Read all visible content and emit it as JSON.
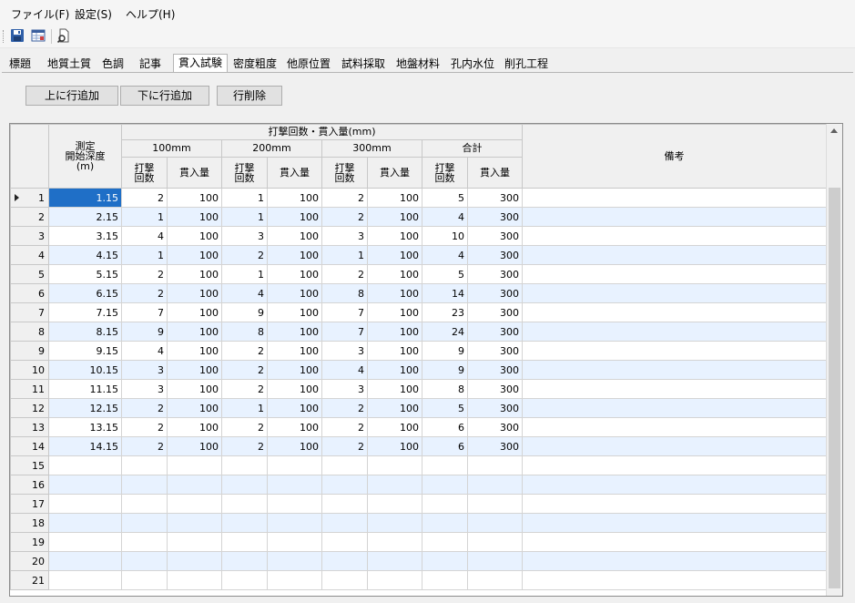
{
  "menu": {
    "file": "ファイル(F)",
    "settings": "設定(S)",
    "help": "ヘルプ(H)"
  },
  "toolbar": {
    "icons": [
      "save-icon",
      "table-view-icon",
      "print-preview-icon"
    ]
  },
  "tabs": [
    {
      "label": "標題",
      "active": false
    },
    {
      "label": "地質土質",
      "active": false
    },
    {
      "label": "色調",
      "active": false
    },
    {
      "label": "記事",
      "active": false
    },
    {
      "label": "貫入試験",
      "active": true
    },
    {
      "label": "密度粗度",
      "active": false
    },
    {
      "label": "他原位置",
      "active": false
    },
    {
      "label": "試料採取",
      "active": false
    },
    {
      "label": "地盤材料",
      "active": false
    },
    {
      "label": "孔内水位",
      "active": false
    },
    {
      "label": "削孔工程",
      "active": false
    }
  ],
  "actions": {
    "add_above": "上に行追加",
    "add_below": "下に行追加",
    "delete_row": "行削除"
  },
  "grid": {
    "header": {
      "depth_line1": "測定",
      "depth_line2": "開始深度",
      "depth_line3": "(m)",
      "group": "打撃回数・貫入量(mm)",
      "g100": "100mm",
      "g200": "200mm",
      "g300": "300mm",
      "gtotal": "合計",
      "blows_line1": "打撃",
      "blows_line2": "回数",
      "pen": "貫入量",
      "remarks": "備考"
    },
    "rows": [
      {
        "no": "1",
        "depth": "1.15",
        "b1": "2",
        "p1": "100",
        "b2": "1",
        "p2": "100",
        "b3": "2",
        "p3": "100",
        "bt": "5",
        "pt": "300",
        "note": ""
      },
      {
        "no": "2",
        "depth": "2.15",
        "b1": "1",
        "p1": "100",
        "b2": "1",
        "p2": "100",
        "b3": "2",
        "p3": "100",
        "bt": "4",
        "pt": "300",
        "note": ""
      },
      {
        "no": "3",
        "depth": "3.15",
        "b1": "4",
        "p1": "100",
        "b2": "3",
        "p2": "100",
        "b3": "3",
        "p3": "100",
        "bt": "10",
        "pt": "300",
        "note": ""
      },
      {
        "no": "4",
        "depth": "4.15",
        "b1": "1",
        "p1": "100",
        "b2": "2",
        "p2": "100",
        "b3": "1",
        "p3": "100",
        "bt": "4",
        "pt": "300",
        "note": ""
      },
      {
        "no": "5",
        "depth": "5.15",
        "b1": "2",
        "p1": "100",
        "b2": "1",
        "p2": "100",
        "b3": "2",
        "p3": "100",
        "bt": "5",
        "pt": "300",
        "note": ""
      },
      {
        "no": "6",
        "depth": "6.15",
        "b1": "2",
        "p1": "100",
        "b2": "4",
        "p2": "100",
        "b3": "8",
        "p3": "100",
        "bt": "14",
        "pt": "300",
        "note": ""
      },
      {
        "no": "7",
        "depth": "7.15",
        "b1": "7",
        "p1": "100",
        "b2": "9",
        "p2": "100",
        "b3": "7",
        "p3": "100",
        "bt": "23",
        "pt": "300",
        "note": ""
      },
      {
        "no": "8",
        "depth": "8.15",
        "b1": "9",
        "p1": "100",
        "b2": "8",
        "p2": "100",
        "b3": "7",
        "p3": "100",
        "bt": "24",
        "pt": "300",
        "note": ""
      },
      {
        "no": "9",
        "depth": "9.15",
        "b1": "4",
        "p1": "100",
        "b2": "2",
        "p2": "100",
        "b3": "3",
        "p3": "100",
        "bt": "9",
        "pt": "300",
        "note": ""
      },
      {
        "no": "10",
        "depth": "10.15",
        "b1": "3",
        "p1": "100",
        "b2": "2",
        "p2": "100",
        "b3": "4",
        "p3": "100",
        "bt": "9",
        "pt": "300",
        "note": ""
      },
      {
        "no": "11",
        "depth": "11.15",
        "b1": "3",
        "p1": "100",
        "b2": "2",
        "p2": "100",
        "b3": "3",
        "p3": "100",
        "bt": "8",
        "pt": "300",
        "note": ""
      },
      {
        "no": "12",
        "depth": "12.15",
        "b1": "2",
        "p1": "100",
        "b2": "1",
        "p2": "100",
        "b3": "2",
        "p3": "100",
        "bt": "5",
        "pt": "300",
        "note": ""
      },
      {
        "no": "13",
        "depth": "13.15",
        "b1": "2",
        "p1": "100",
        "b2": "2",
        "p2": "100",
        "b3": "2",
        "p3": "100",
        "bt": "6",
        "pt": "300",
        "note": ""
      },
      {
        "no": "14",
        "depth": "14.15",
        "b1": "2",
        "p1": "100",
        "b2": "2",
        "p2": "100",
        "b3": "2",
        "p3": "100",
        "bt": "6",
        "pt": "300",
        "note": ""
      },
      {
        "no": "15",
        "depth": "",
        "b1": "",
        "p1": "",
        "b2": "",
        "p2": "",
        "b3": "",
        "p3": "",
        "bt": "",
        "pt": "",
        "note": ""
      },
      {
        "no": "16",
        "depth": "",
        "b1": "",
        "p1": "",
        "b2": "",
        "p2": "",
        "b3": "",
        "p3": "",
        "bt": "",
        "pt": "",
        "note": ""
      },
      {
        "no": "17",
        "depth": "",
        "b1": "",
        "p1": "",
        "b2": "",
        "p2": "",
        "b3": "",
        "p3": "",
        "bt": "",
        "pt": "",
        "note": ""
      },
      {
        "no": "18",
        "depth": "",
        "b1": "",
        "p1": "",
        "b2": "",
        "p2": "",
        "b3": "",
        "p3": "",
        "bt": "",
        "pt": "",
        "note": ""
      },
      {
        "no": "19",
        "depth": "",
        "b1": "",
        "p1": "",
        "b2": "",
        "p2": "",
        "b3": "",
        "p3": "",
        "bt": "",
        "pt": "",
        "note": ""
      },
      {
        "no": "20",
        "depth": "",
        "b1": "",
        "p1": "",
        "b2": "",
        "p2": "",
        "b3": "",
        "p3": "",
        "bt": "",
        "pt": "",
        "note": ""
      },
      {
        "no": "21",
        "depth": "",
        "b1": "",
        "p1": "",
        "b2": "",
        "p2": "",
        "b3": "",
        "p3": "",
        "bt": "",
        "pt": "",
        "note": ""
      }
    ]
  },
  "colors": {
    "selection": "#1f6fc7",
    "alt_row": "#e8f2ff",
    "panel": "#f0f0f0"
  }
}
